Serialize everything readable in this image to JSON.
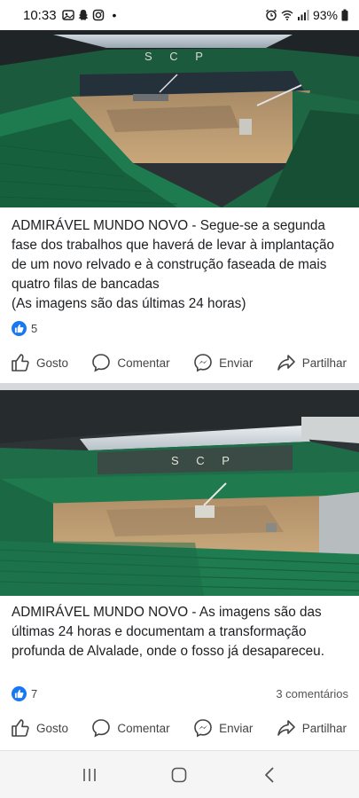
{
  "status_bar": {
    "time": "10:33",
    "battery": "93%",
    "dot": "•",
    "left_icons": [
      "photos-icon",
      "snapchat-icon",
      "instagram-icon"
    ],
    "right_icons": [
      "alarm-icon",
      "wifi-icon",
      "signal-icon",
      "battery-icon"
    ]
  },
  "posts": [
    {
      "text": "ADMIRÁVEL MUNDO NOVO - Segue-se a segunda fase dos trabalhos que haverá de levar à implantação de um novo relvado e à construção faseada de mais quatro filas de bancadas\n(As imagens são das últimas 24 horas)",
      "likes": "5",
      "comments": "",
      "image_caption": "S C P"
    },
    {
      "text": "ADMIRÁVEL MUNDO NOVO - As imagens são das últimas 24 horas e documentam a transformação profunda de Alvalade, onde o fosso já desapareceu.",
      "likes": "7",
      "comments": "3 comentários",
      "image_caption": "S C P"
    }
  ],
  "actions": {
    "like": "Gosto",
    "comment": "Comentar",
    "send": "Enviar",
    "share": "Partilhar"
  },
  "colors": {
    "accent": "#1877f2",
    "separator": "#d6d8dc",
    "seat_green": "#1e7a4f",
    "dirt": "#b9966a"
  },
  "nav": [
    "recents-icon",
    "home-icon",
    "back-icon"
  ]
}
